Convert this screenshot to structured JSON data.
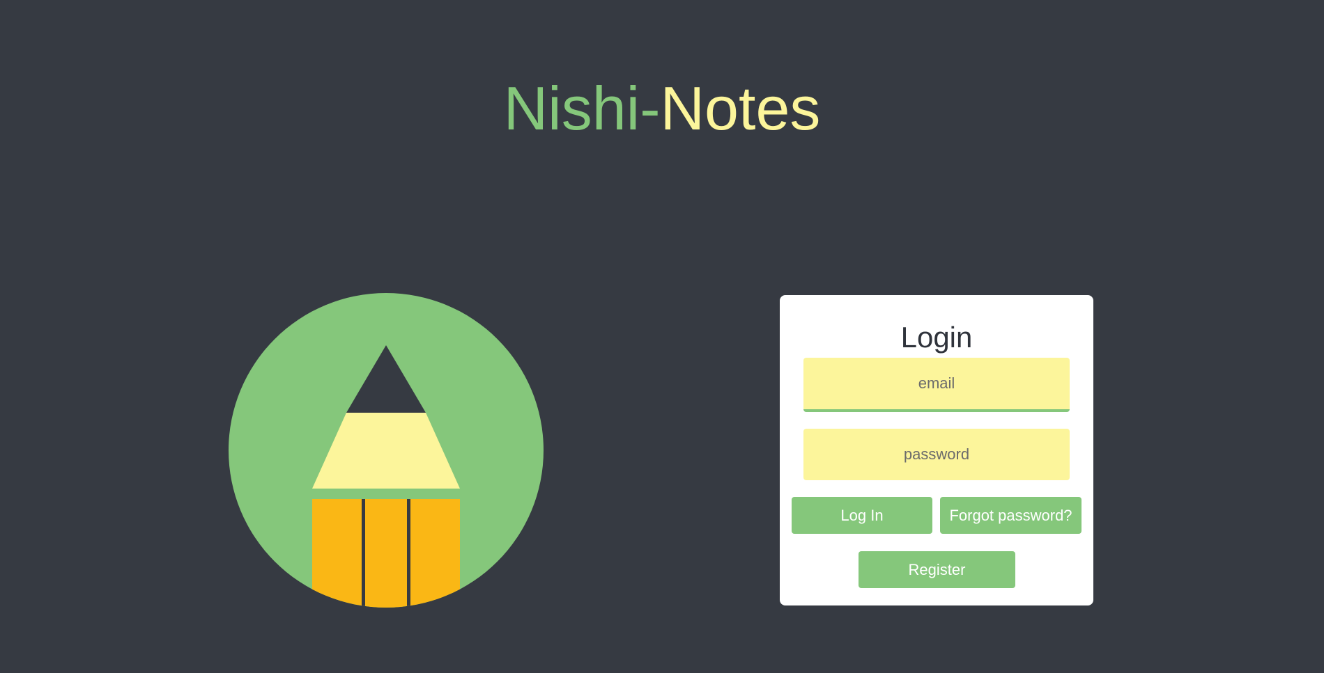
{
  "app": {
    "brand_part1": "Nishi-",
    "brand_part2": "Notes"
  },
  "colors": {
    "background": "#363a42",
    "green": "#85c77b",
    "yellow": "#fcf59b",
    "orange": "#fab715",
    "dark": "#363a42"
  },
  "logo": {
    "icon": "pencil-icon"
  },
  "login": {
    "title": "Login",
    "email_placeholder": "email",
    "password_placeholder": "password",
    "login_button": "Log In",
    "forgot_button": "Forgot password?",
    "register_button": "Register"
  }
}
